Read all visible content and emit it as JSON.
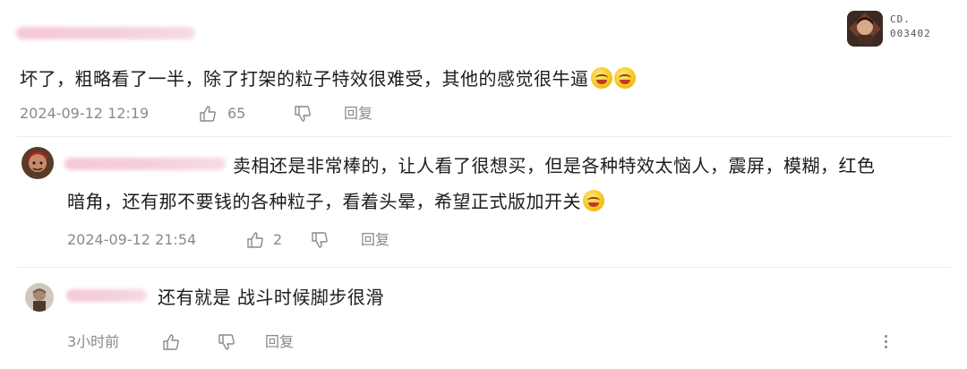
{
  "header": {
    "user_badge_line1": "CD.",
    "user_badge_line2": "003402"
  },
  "comments": [
    {
      "text": "坏了，粗略看了一半，除了打架的粒子特效很难受，其他的感觉很牛逼",
      "emoji": [
        "laugh-cry-emoji",
        "laugh-cry-emoji"
      ],
      "timestamp": "2024-09-12 12:19",
      "likes": "65",
      "reply_label": "回复"
    },
    {
      "text_line1": "卖相还是非常棒的，让人看了很想买，但是各种特效太恼人，震屏，模糊，红色",
      "text_line2": "暗角，还有那不要钱的各种粒子，看着头晕，希望正式版加开关",
      "emoji": [
        "laugh-cry-emoji"
      ],
      "timestamp": "2024-09-12 21:54",
      "likes": "2",
      "reply_label": "回复"
    },
    {
      "text": "还有就是 战斗时候脚步很滑",
      "timestamp": "3小时前",
      "reply_label": "回复"
    }
  ],
  "colors": {
    "text": "#1c1c1c",
    "meta": "#8a8a8a",
    "name_blur": "#f5c9d6",
    "divider": "#ececec"
  }
}
